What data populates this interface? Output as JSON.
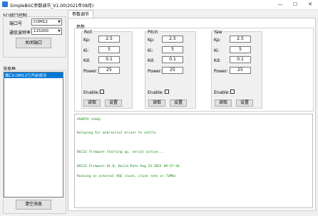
{
  "window": {
    "title": "SimpleBGC参数调节_V1.00(2021年08月)",
    "minimize": "—",
    "maximize": "☐",
    "close": "✕"
  },
  "serial": {
    "group_label": "SCI接口控制",
    "port_label": "端口号",
    "port_value": "COM12",
    "baud_label": "通信波特率",
    "baud_value": "115200",
    "close_button": "关闭端口"
  },
  "messages": {
    "group_label": "消息框",
    "items": [
      "端口COM12已开启成功"
    ],
    "clear_button": "清空消息"
  },
  "tabs": [
    {
      "label": "参数调节"
    }
  ],
  "params": {
    "group_label": "参数",
    "axes": [
      {
        "title": "Roll",
        "kp": "2.5",
        "ki": "5",
        "kd": "0.1",
        "power": "25",
        "enable_label": "Enable:",
        "read_button": "读取",
        "set_button": "设置"
      },
      {
        "title": "Pitch",
        "kp": "2.5",
        "ki": "5",
        "kd": "0.1",
        "power": "25",
        "enable_label": "Enable:",
        "read_button": "读取",
        "set_button": "设置"
      },
      {
        "title": "Yaw",
        "kp": "2.5",
        "ki": "5",
        "kd": "0.1",
        "power": "25",
        "enable_label": "Enable:",
        "read_button": "读取",
        "set_button": "设置"
      }
    ],
    "labels": {
      "kp": "Kp:",
      "ki": "Ki:",
      "kd": "Kd:",
      "power": "Power:"
    }
  },
  "log": {
    "color": "#0a8a0a",
    "lines": [
      "USART4 ready",
      "Delaying for mcb/serial driver to settle",
      "BGC32 firmware starting up, serial active...",
      "BGC32 Firmware V1.0, Build Date Aug 23 2021 09:57:44",
      "Running on external HSE clock, clock rate is 72MHz"
    ]
  }
}
